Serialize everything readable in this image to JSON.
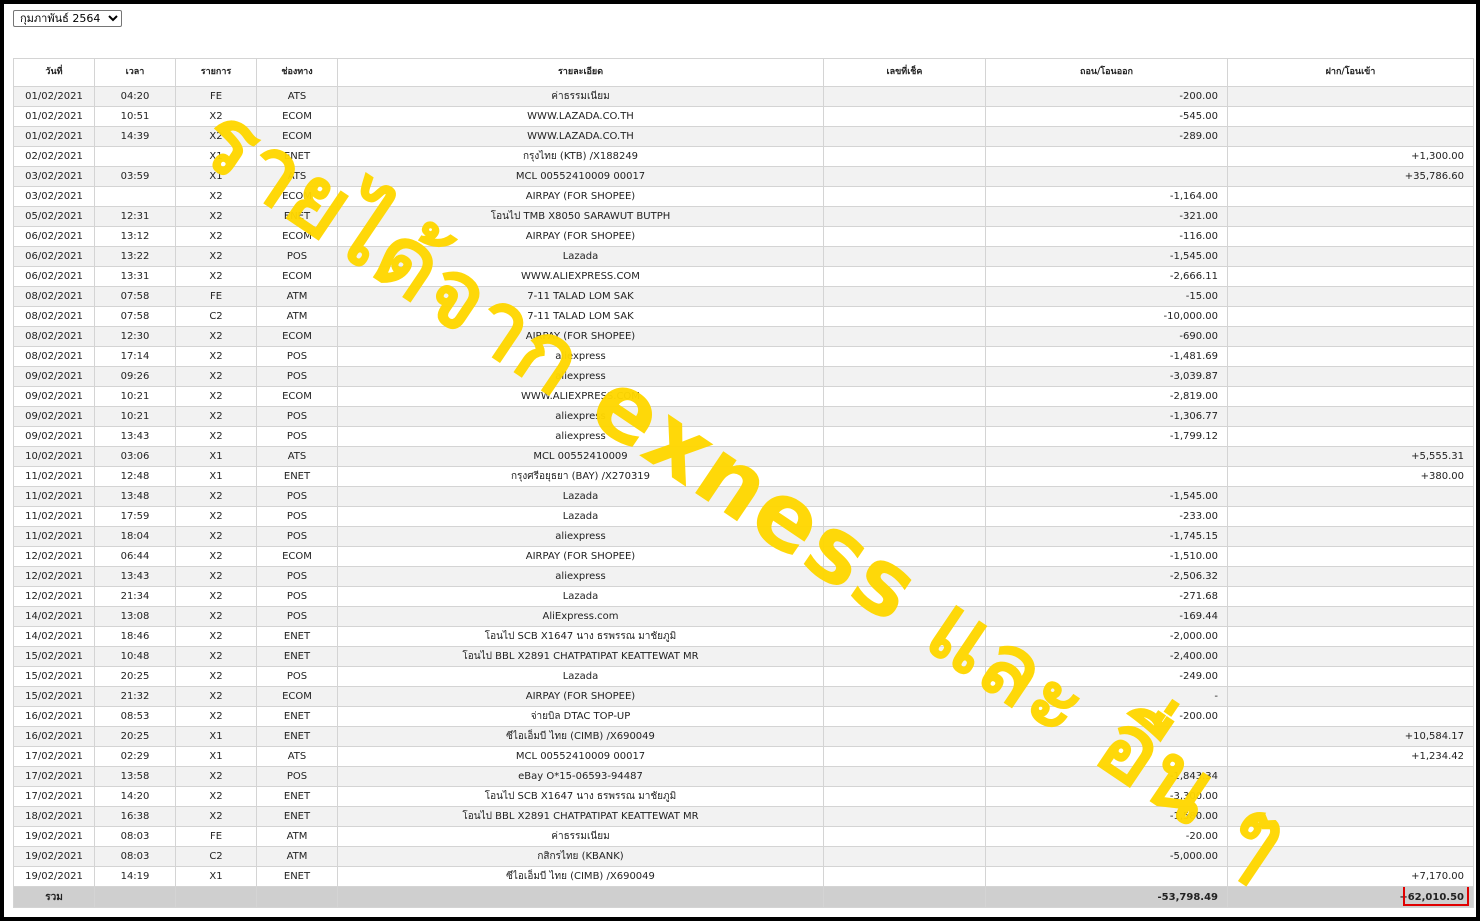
{
  "month_select": {
    "selected": "กุมภาพันธ์ 2564"
  },
  "columns": [
    "วันที่",
    "เวลา",
    "รายการ",
    "ช่องทาง",
    "รายละเอียด",
    "เลขที่เช็ค",
    "ถอน/โอนออก",
    "ฝาก/โอนเข้า"
  ],
  "rows": [
    [
      "01/02/2021",
      "04:20",
      "FE",
      "ATS",
      "ค่าธรรมเนียม",
      "",
      "-200.00",
      ""
    ],
    [
      "01/02/2021",
      "10:51",
      "X2",
      "ECOM",
      "WWW.LAZADA.CO.TH",
      "",
      "-545.00",
      ""
    ],
    [
      "01/02/2021",
      "14:39",
      "X2",
      "ECOM",
      "WWW.LAZADA.CO.TH",
      "",
      "-289.00",
      ""
    ],
    [
      "02/02/2021",
      "",
      "X1",
      "ENET",
      "กรุงไทย (KTB) /X188249",
      "",
      "",
      "+1,300.00"
    ],
    [
      "03/02/2021",
      "03:59",
      "X1",
      "ATS",
      "MCL 00552410009 00017",
      "",
      "",
      "+35,786.60"
    ],
    [
      "03/02/2021",
      "",
      "X2",
      "ECOM",
      "AIRPAY (FOR SHOPEE)",
      "",
      "-1,164.00",
      ""
    ],
    [
      "05/02/2021",
      "12:31",
      "X2",
      "ENET",
      "โอนไป TMB X8050 SARAWUT BUTPH",
      "",
      "-321.00",
      ""
    ],
    [
      "06/02/2021",
      "13:12",
      "X2",
      "ECOM",
      "AIRPAY (FOR SHOPEE)",
      "",
      "-116.00",
      ""
    ],
    [
      "06/02/2021",
      "13:22",
      "X2",
      "POS",
      "Lazada",
      "",
      "-1,545.00",
      ""
    ],
    [
      "06/02/2021",
      "13:31",
      "X2",
      "ECOM",
      "WWW.ALIEXPRESS.COM",
      "",
      "-2,666.11",
      ""
    ],
    [
      "08/02/2021",
      "07:58",
      "FE",
      "ATM",
      "7-11 TALAD LOM SAK",
      "",
      "-15.00",
      ""
    ],
    [
      "08/02/2021",
      "07:58",
      "C2",
      "ATM",
      "7-11 TALAD LOM SAK",
      "",
      "-10,000.00",
      ""
    ],
    [
      "08/02/2021",
      "12:30",
      "X2",
      "ECOM",
      "AIRPAY (FOR SHOPEE)",
      "",
      "-690.00",
      ""
    ],
    [
      "08/02/2021",
      "17:14",
      "X2",
      "POS",
      "aliexpress",
      "",
      "-1,481.69",
      ""
    ],
    [
      "09/02/2021",
      "09:26",
      "X2",
      "POS",
      "aliexpress",
      "",
      "-3,039.87",
      ""
    ],
    [
      "09/02/2021",
      "10:21",
      "X2",
      "ECOM",
      "WWW.ALIEXPRESS.COM",
      "",
      "-2,819.00",
      ""
    ],
    [
      "09/02/2021",
      "10:21",
      "X2",
      "POS",
      "aliexpress",
      "",
      "-1,306.77",
      ""
    ],
    [
      "09/02/2021",
      "13:43",
      "X2",
      "POS",
      "aliexpress",
      "",
      "-1,799.12",
      ""
    ],
    [
      "10/02/2021",
      "03:06",
      "X1",
      "ATS",
      "MCL 00552410009",
      "",
      "",
      "+5,555.31"
    ],
    [
      "11/02/2021",
      "12:48",
      "X1",
      "ENET",
      "กรุงศรีอยุธยา (BAY) /X270319",
      "",
      "",
      "+380.00"
    ],
    [
      "11/02/2021",
      "13:48",
      "X2",
      "POS",
      "Lazada",
      "",
      "-1,545.00",
      ""
    ],
    [
      "11/02/2021",
      "17:59",
      "X2",
      "POS",
      "Lazada",
      "",
      "-233.00",
      ""
    ],
    [
      "11/02/2021",
      "18:04",
      "X2",
      "POS",
      "aliexpress",
      "",
      "-1,745.15",
      ""
    ],
    [
      "12/02/2021",
      "06:44",
      "X2",
      "ECOM",
      "AIRPAY (FOR SHOPEE)",
      "",
      "-1,510.00",
      ""
    ],
    [
      "12/02/2021",
      "13:43",
      "X2",
      "POS",
      "aliexpress",
      "",
      "-2,506.32",
      ""
    ],
    [
      "12/02/2021",
      "21:34",
      "X2",
      "POS",
      "Lazada",
      "",
      "-271.68",
      ""
    ],
    [
      "14/02/2021",
      "13:08",
      "X2",
      "POS",
      "AliExpress.com",
      "",
      "-169.44",
      ""
    ],
    [
      "14/02/2021",
      "18:46",
      "X2",
      "ENET",
      "โอนไป SCB X1647 นาง ธรพรรณ มาชัยภูมิ",
      "",
      "-2,000.00",
      ""
    ],
    [
      "15/02/2021",
      "10:48",
      "X2",
      "ENET",
      "โอนไป BBL X2891 CHATPATIPAT KEATTEWAT MR",
      "",
      "-2,400.00",
      ""
    ],
    [
      "15/02/2021",
      "20:25",
      "X2",
      "POS",
      "Lazada",
      "",
      "-249.00",
      ""
    ],
    [
      "15/02/2021",
      "21:32",
      "X2",
      "ECOM",
      "AIRPAY (FOR SHOPEE)",
      "",
      "-",
      ""
    ],
    [
      "16/02/2021",
      "08:53",
      "X2",
      "ENET",
      "จ่ายบิล DTAC TOP-UP",
      "",
      "-200.00",
      ""
    ],
    [
      "16/02/2021",
      "20:25",
      "X1",
      "ENET",
      "ซีไอเอ็มบี ไทย (CIMB) /X690049",
      "",
      "",
      "+10,584.17"
    ],
    [
      "17/02/2021",
      "02:29",
      "X1",
      "ATS",
      "MCL 00552410009 00017",
      "",
      "",
      "+1,234.42"
    ],
    [
      "17/02/2021",
      "13:58",
      "X2",
      "POS",
      "eBay O*15-06593-94487",
      "",
      "-1,843.34",
      ""
    ],
    [
      "17/02/2021",
      "14:20",
      "X2",
      "ENET",
      "โอนไป SCB X1647 นาง ธรพรรณ มาชัยภูมิ",
      "",
      "-3,300.00",
      ""
    ],
    [
      "18/02/2021",
      "16:38",
      "X2",
      "ENET",
      "โอนไป BBL X2891 CHATPATIPAT KEATTEWAT MR",
      "",
      "-1,580.00",
      ""
    ],
    [
      "19/02/2021",
      "08:03",
      "FE",
      "ATM",
      "ค่าธรรมเนียม",
      "",
      "-20.00",
      ""
    ],
    [
      "19/02/2021",
      "08:03",
      "C2",
      "ATM",
      "กสิกรไทย (KBANK)",
      "",
      "-5,000.00",
      ""
    ],
    [
      "19/02/2021",
      "14:19",
      "X1",
      "ENET",
      "ซีไอเอ็มบี ไทย (CIMB) /X690049",
      "",
      "",
      "+7,170.00"
    ]
  ],
  "totals": {
    "label": "รวม",
    "withdrawal": "-53,798.49",
    "deposit": "+62,010.50"
  },
  "watermark": {
    "text": "รายได้จาก exness และ อื่น ๆ",
    "color": "#ffd700"
  },
  "highlight_color": "#e00000"
}
